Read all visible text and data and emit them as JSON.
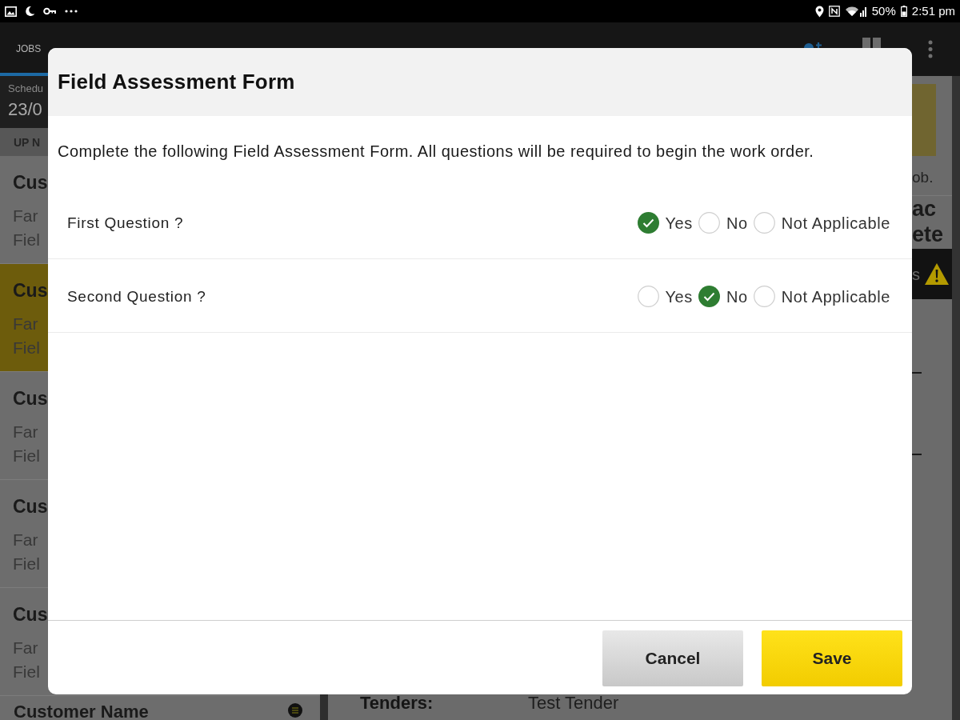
{
  "status_bar": {
    "battery": "50%",
    "time": "2:51 pm"
  },
  "app_bar": {
    "tabs": [
      {
        "label": "JOBS",
        "selected": true
      }
    ]
  },
  "schedule": {
    "label": "Schedu",
    "date": "23/0"
  },
  "list_section": "UP N",
  "jobs": [
    {
      "customer": "Cus",
      "farm": "Far",
      "field": "Fiel",
      "selected": false
    },
    {
      "customer": "Cus",
      "farm": "Far",
      "field": "Fiel",
      "selected": true
    },
    {
      "customer": "Cus",
      "farm": "Far",
      "field": "Fiel",
      "selected": false
    },
    {
      "customer": "Cus",
      "farm": "Far",
      "field": "Fiel",
      "selected": false
    },
    {
      "customer": "Cus",
      "farm": "Far",
      "field": "Fiel",
      "selected": false
    }
  ],
  "next_job": {
    "customer": "Customer Name"
  },
  "detail_panel": {
    "note": "ob.",
    "heading_lines": [
      "ac",
      "ete"
    ],
    "alert": "s",
    "tenders_label": "Tenders:",
    "tenders_value": "Test Tender"
  },
  "dialog": {
    "title": "Field Assessment Form",
    "description": "Complete the following Field Assessment Form. All questions will be required to begin the work order.",
    "questions": [
      {
        "label": "First Question ?",
        "options": [
          {
            "label": "Yes",
            "selected": true
          },
          {
            "label": "No",
            "selected": false
          },
          {
            "label": "Not Applicable",
            "selected": false
          }
        ]
      },
      {
        "label": "Second Question ?",
        "options": [
          {
            "label": "Yes",
            "selected": false
          },
          {
            "label": "No",
            "selected": true
          },
          {
            "label": "Not Applicable",
            "selected": false
          }
        ]
      }
    ],
    "buttons": [
      {
        "label": "Cancel",
        "kind": "secondary"
      },
      {
        "label": "Save",
        "kind": "primary"
      }
    ]
  }
}
